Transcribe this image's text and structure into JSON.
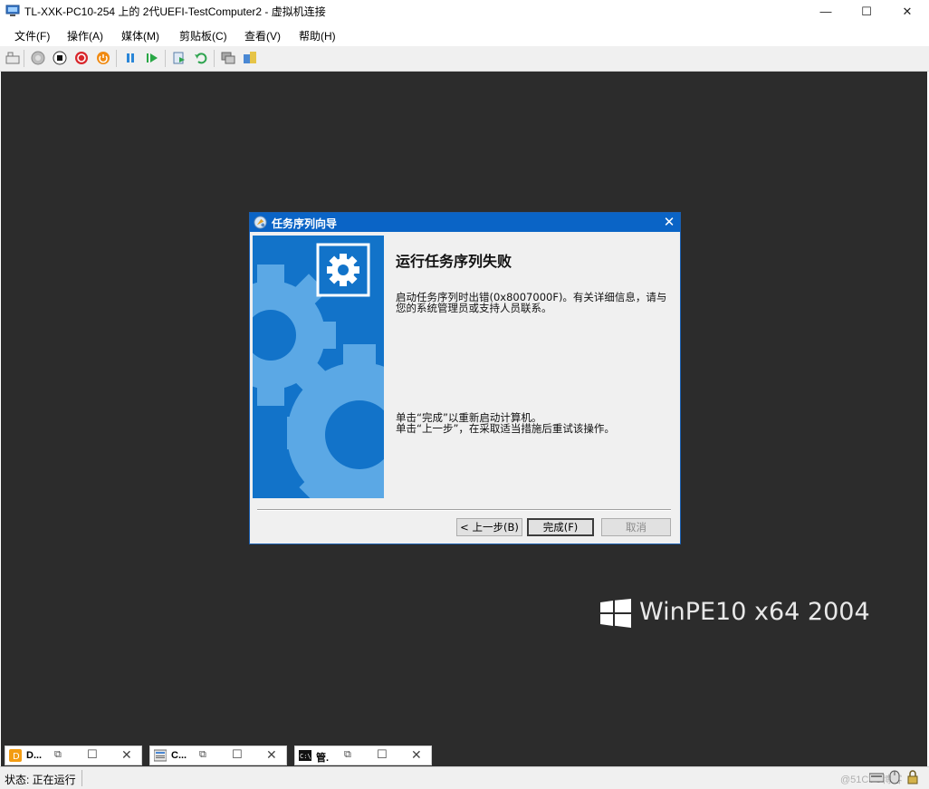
{
  "window": {
    "title": "TL-XXK-PC10-254 上的 2代UEFI-TestComputer2 - 虚拟机连接",
    "minimize": "—",
    "maximize": "☐",
    "close": "✕"
  },
  "menu": [
    "文件(F)",
    "操作(A)",
    "媒体(M)",
    "剪贴板(C)",
    "查看(V)",
    "帮助(H)"
  ],
  "dialog": {
    "title": "任务序列向导",
    "close": "✕",
    "heading": "运行任务序列失败",
    "error_line1": "启动任务序列时出错(0x8007000F)。有关详细信息，请与",
    "error_line2": "您的系统管理员或支持人员联系。",
    "hint_line1": "单击“完成”以重新启动计算机。",
    "hint_line2": "单击“上一步”，在采取适当措施后重试该操作。",
    "back_button": "< 上一步(B)",
    "finish_button": "完成(F)",
    "cancel_button": "取消"
  },
  "watermark": "WinPE10 x64 2004",
  "minimized_windows": [
    {
      "label": "D..."
    },
    {
      "label": "C..."
    },
    {
      "label": "管."
    }
  ],
  "status": {
    "text": "状态: 正在运行",
    "credit": "@51CTO博客"
  },
  "colors": {
    "dialog_title": "#0a64c6",
    "banner": "#1273c9",
    "vm_background": "#2c2c2c"
  }
}
